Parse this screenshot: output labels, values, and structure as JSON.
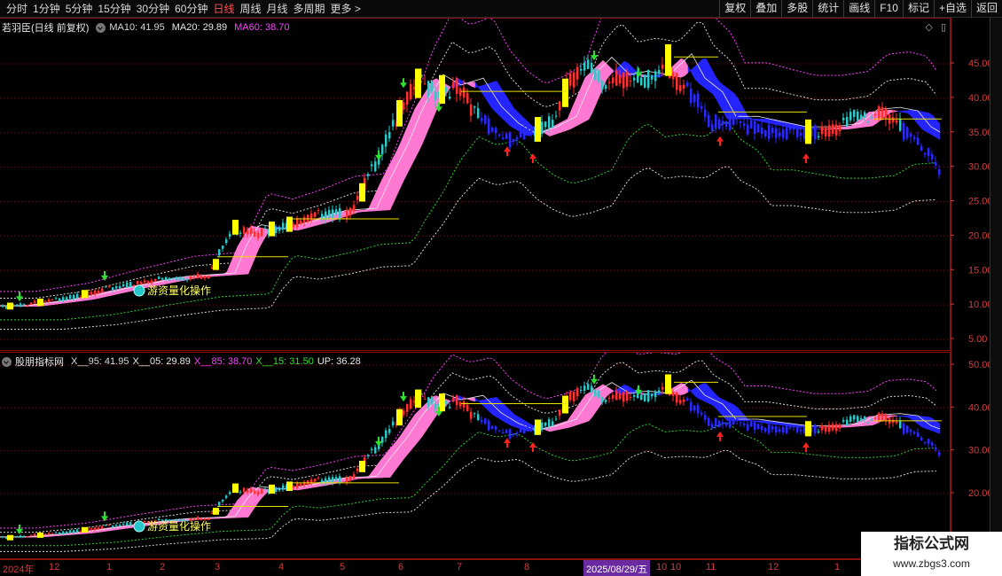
{
  "toolbar": {
    "periods": [
      "分时",
      "1分钟",
      "5分钟",
      "15分钟",
      "30分钟",
      "60分钟",
      "日线",
      "周线",
      "月线",
      "多周期",
      "更多 >"
    ],
    "active_index": 6,
    "buttons": [
      "复权",
      "叠加",
      "多股",
      "统计",
      "画线",
      "F10",
      "标记",
      "+自选",
      "返回"
    ]
  },
  "main_panel": {
    "title": "若羽臣(日线 前复权)",
    "ma10": "MA10: 41.95",
    "ma20": "MA20: 29.89",
    "ma60": "MA60: 38.70",
    "price_ticks": [
      "45.00",
      "40.00",
      "35.00",
      "30.00",
      "25.00",
      "20.00",
      "15.00",
      "10.00",
      "5.00"
    ],
    "annotation": "游资量化操作",
    "icons": [
      "diamond-icon",
      "copy-icon"
    ]
  },
  "sub_panel": {
    "title": "股朋指标网",
    "x95": "X__95: 41.95",
    "x05": "X__05: 29.89",
    "x85": "X__85: 38.70",
    "x15": "X__15: 31.50",
    "up": "UP: 36.28",
    "price_ticks": [
      "50.00",
      "40.00",
      "30.00",
      "20.00"
    ],
    "annotation": "游资量化操作"
  },
  "date_axis": {
    "labels": [
      "2024年",
      "12",
      "1",
      "2",
      "3",
      "4",
      "5",
      "6",
      "7",
      "8",
      "9",
      "10",
      "11",
      "12",
      "1"
    ],
    "cursor": "2025/08/29/五"
  },
  "watermark": {
    "title": "指标公式网",
    "url": "www.zbgs3.com"
  },
  "colors": {
    "band_pink": "#ff78d2",
    "band_blue": "#1e1eff",
    "candle_up": "#ff3030",
    "candle_signal": "#ffff00",
    "axis_red": "#d23c3c"
  },
  "chart_data": {
    "type": "candlestick",
    "title": "若羽臣(日线 前复权)",
    "ylim": [
      4,
      50
    ],
    "x": [
      "2024-11",
      "2024-12",
      "2025-01",
      "2025-02",
      "2025-03",
      "2025-04",
      "2025-05",
      "2025-06",
      "2025-07",
      "2025-08",
      "2025-09",
      "2025-10",
      "2025-11",
      "2025-12",
      "2026-01"
    ],
    "close_approx": [
      10.2,
      11.5,
      13.5,
      15.0,
      19.5,
      22.0,
      23.5,
      38.0,
      42.0,
      36.0,
      42.0,
      45.0,
      37.0,
      35.0,
      30.0
    ],
    "series": [
      {
        "name": "MA10",
        "last": 41.95
      },
      {
        "name": "MA20",
        "last": 29.89
      },
      {
        "name": "MA60",
        "last": 38.7
      }
    ]
  }
}
